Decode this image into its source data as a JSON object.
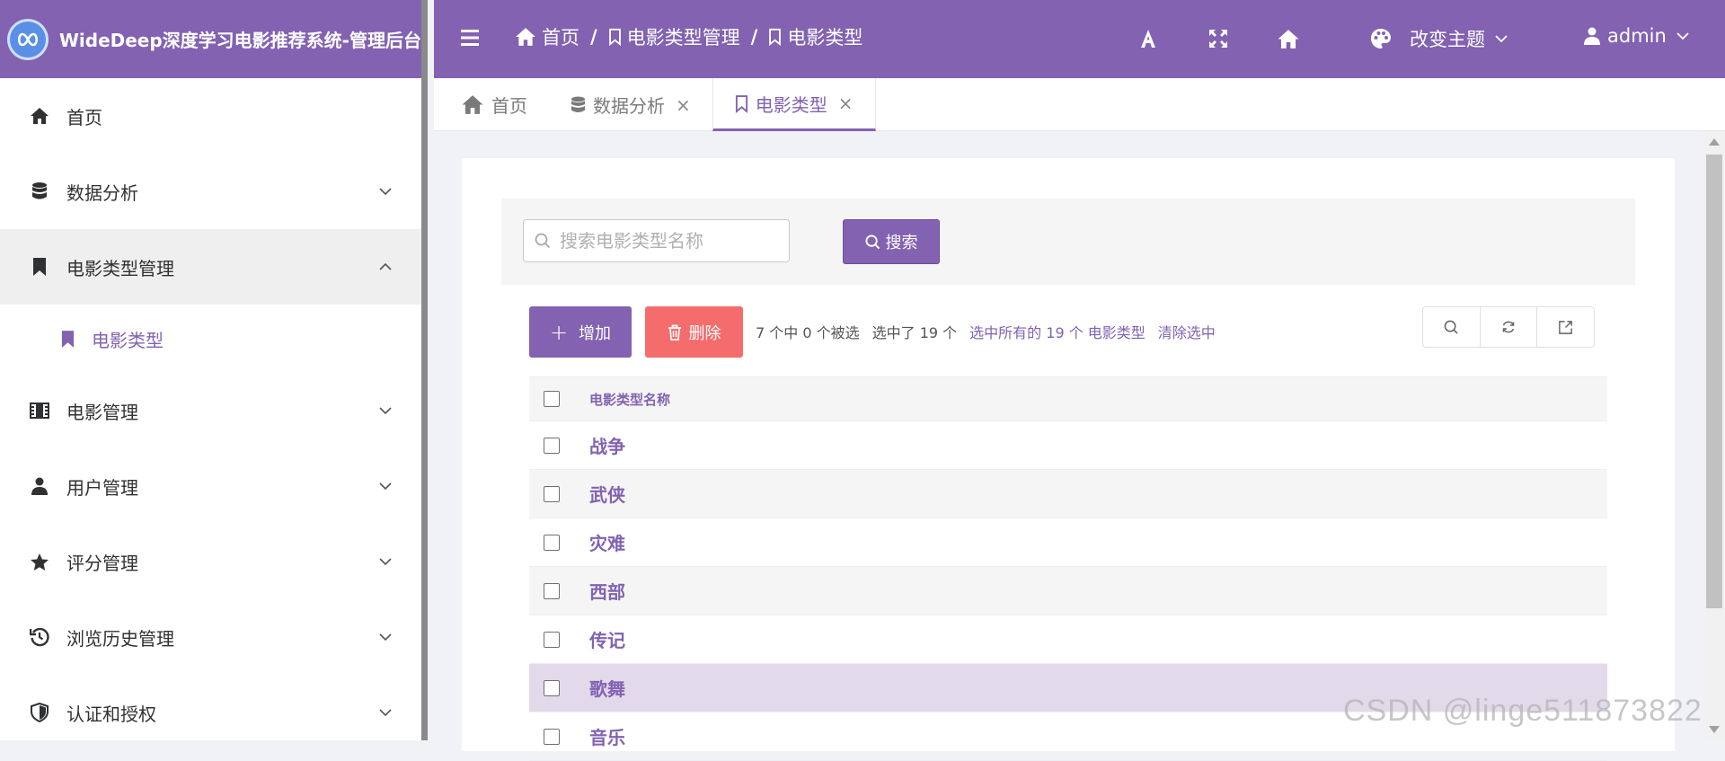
{
  "app": {
    "title": "WideDeep深度学习电影推荐系统-管理后台"
  },
  "sidebar": {
    "items": [
      {
        "label": "首页"
      },
      {
        "label": "数据分析"
      },
      {
        "label": "电影类型管理"
      },
      {
        "label": "电影类型"
      },
      {
        "label": "电影管理"
      },
      {
        "label": "用户管理"
      },
      {
        "label": "评分管理"
      },
      {
        "label": "浏览历史管理"
      },
      {
        "label": "认证和授权"
      }
    ]
  },
  "header": {
    "breadcrumb": [
      "首页",
      "电影类型管理",
      "电影类型"
    ],
    "separator": "/",
    "theme_label": "改变主题",
    "user_label": "admin"
  },
  "tabs": [
    {
      "label": "首页"
    },
    {
      "label": "数据分析",
      "close": "×"
    },
    {
      "label": "电影类型",
      "close": "×"
    }
  ],
  "search": {
    "placeholder": "搜索电影类型名称",
    "button_label": "搜索"
  },
  "toolbar": {
    "add_label": "增加",
    "delete_label": "删除",
    "count_text": "7 个中 0 个被选",
    "selected_text": "选中了 19 个",
    "select_all_link": "选中所有的 19 个 电影类型",
    "clear_link": "清除选中"
  },
  "table": {
    "header": "电影类型名称",
    "rows": [
      "战争",
      "武侠",
      "灾难",
      "西部",
      "传记",
      "歌舞",
      "音乐"
    ]
  },
  "watermark": "CSDN @linge511873822",
  "colors": {
    "primary": "#8262b1",
    "danger": "#f56c6c",
    "highlight_row": "#e2d9ea"
  }
}
